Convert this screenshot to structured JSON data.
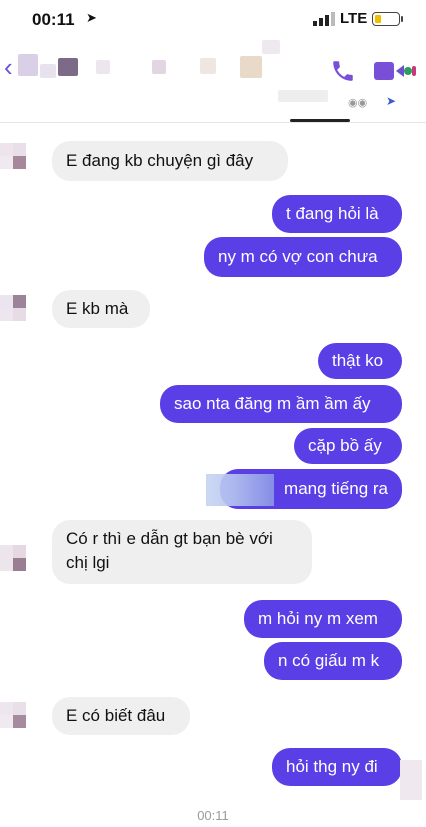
{
  "status_bar": {
    "time": "00:11",
    "network": "LTE"
  },
  "header": {
    "back_icon": "chevron-left-icon",
    "call_icon": "phone-icon",
    "video_icon": "video-icon"
  },
  "messages": [
    {
      "side": "in",
      "text": "E đang kb chuyện gì đây"
    },
    {
      "side": "out",
      "text": "t đang hỏi là"
    },
    {
      "side": "out",
      "text": "ny m có vợ con chưa"
    },
    {
      "side": "in",
      "text": "E kb mà"
    },
    {
      "side": "out",
      "text": "thật ko"
    },
    {
      "side": "out",
      "text": "sao nta đăng m ầm ầm ấy"
    },
    {
      "side": "out",
      "text": "cặp bồ ấy"
    },
    {
      "side": "out",
      "text": "mang tiếng ra"
    },
    {
      "side": "in",
      "text": "Có r thì e dẫn gt bạn bè với chị lgi"
    },
    {
      "side": "out",
      "text": "m hỏi ny m xem"
    },
    {
      "side": "out",
      "text": "n có giấu m k"
    },
    {
      "side": "in",
      "text": "E có biết đâu"
    },
    {
      "side": "out",
      "text": "hỏi thg ny đi"
    }
  ],
  "footer_time": "00:11",
  "colors": {
    "outgoing": "#5a3fe6",
    "incoming": "#efeff0",
    "accent": "#6b52d6"
  }
}
